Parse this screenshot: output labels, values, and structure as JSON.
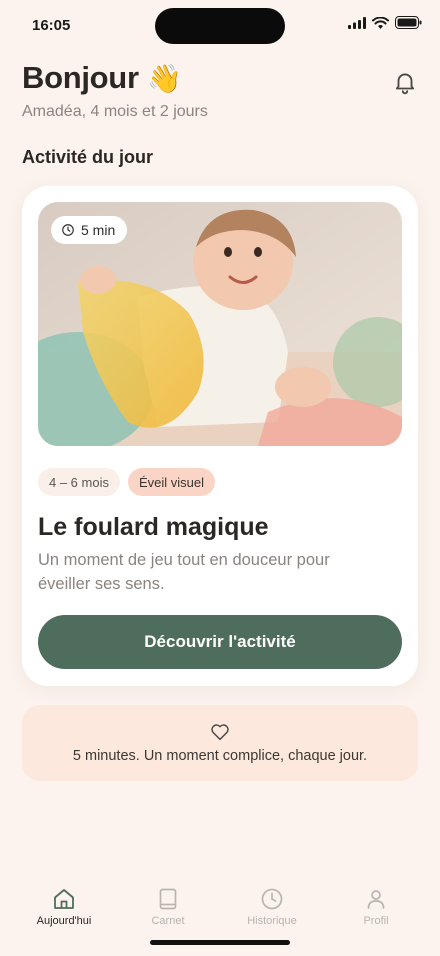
{
  "status_bar": {
    "time": "16:05"
  },
  "header": {
    "greeting": "Bonjour",
    "greeting_emoji": "👋",
    "subtitle": "Amadéa, 4 mois et 2 jours"
  },
  "section_title": "Activité du jour",
  "activity": {
    "duration": "5 min",
    "tags": [
      "4 – 6 mois",
      "Éveil visuel"
    ],
    "title": "Le foulard magique",
    "description": "Un moment de jeu tout en douceur pour éveiller ses sens.",
    "cta_label": "Découvrir l'activité"
  },
  "quote": {
    "text": "5 minutes. Un moment complice, chaque jour."
  },
  "tabs": [
    {
      "label": "Aujourd'hui",
      "icon": "home-icon",
      "active": true
    },
    {
      "label": "Carnet",
      "icon": "book-icon",
      "active": false
    },
    {
      "label": "Historique",
      "icon": "clock-icon",
      "active": false
    },
    {
      "label": "Profil",
      "icon": "user-icon",
      "active": false
    }
  ],
  "colors": {
    "background": "#fcf3ee",
    "primary": "#4e6d5c",
    "tag_accent": "#fad5c5",
    "quote_bg": "#fde8dd"
  }
}
